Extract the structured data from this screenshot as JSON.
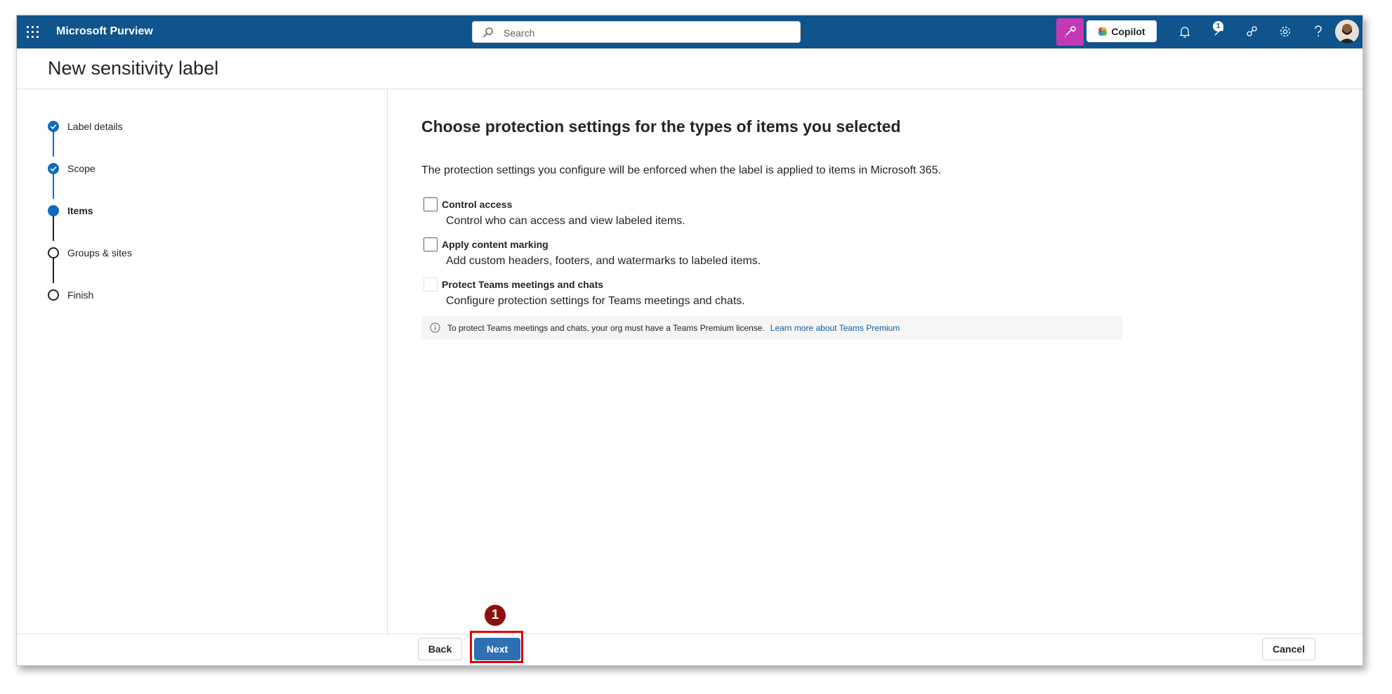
{
  "app": {
    "title": "Microsoft Purview"
  },
  "search": {
    "placeholder": "Search"
  },
  "header": {
    "copilot_label": "Copilot",
    "notification_badge": "1"
  },
  "page": {
    "title": "New sensitivity label"
  },
  "stepper": {
    "steps": [
      {
        "label": "Label details",
        "state": "completed"
      },
      {
        "label": "Scope",
        "state": "completed"
      },
      {
        "label": "Items",
        "state": "current"
      },
      {
        "label": "Groups & sites",
        "state": "pending"
      },
      {
        "label": "Finish",
        "state": "pending"
      }
    ]
  },
  "main": {
    "title": "Choose protection settings for the types of items you selected",
    "description": "The protection settings you configure will be enforced when the label is applied to items in Microsoft 365.",
    "options": [
      {
        "title": "Control access",
        "description": "Control who can access and view labeled items.",
        "checked": false,
        "disabled": false
      },
      {
        "title": "Apply content marking",
        "description": "Add custom headers, footers, and watermarks to labeled items.",
        "checked": false,
        "disabled": false
      },
      {
        "title": "Protect Teams meetings and chats",
        "description": "Configure protection settings for Teams meetings and chats.",
        "checked": false,
        "disabled": true
      }
    ],
    "info": {
      "text": "To protect Teams meetings and chats, your org must have a Teams Premium license.",
      "link": "Learn more about Teams Premium"
    }
  },
  "footer": {
    "back_label": "Back",
    "next_label": "Next",
    "cancel_label": "Cancel"
  },
  "annotation": {
    "marker": "1"
  },
  "colors": {
    "topbar": "#0f548c",
    "accent": "#0f6cbd",
    "copilot_tile": "#c239b3",
    "highlight": "#e00000",
    "marker": "#8e0e0e"
  }
}
